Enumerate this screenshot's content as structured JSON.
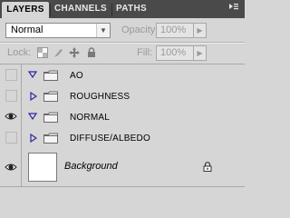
{
  "tabs": [
    {
      "label": "LAYERS",
      "active": true
    },
    {
      "label": "CHANNELS",
      "active": false
    },
    {
      "label": "PATHS",
      "active": false
    }
  ],
  "panel_menu_icon": "panel-menu-icon",
  "options": {
    "blend_mode": "Normal",
    "opacity_label": "Opacity:",
    "opacity_value": "100%",
    "lock_label": "Lock:",
    "fill_label": "Fill:",
    "fill_value": "100%"
  },
  "layers": [
    {
      "name": "AO",
      "type": "group",
      "expanded": true,
      "visible": false
    },
    {
      "name": "ROUGHNESS",
      "type": "group",
      "expanded": false,
      "visible": false
    },
    {
      "name": "NORMAL",
      "type": "group",
      "expanded": true,
      "visible": true
    },
    {
      "name": "DIFFUSE/ALBEDO",
      "type": "group",
      "expanded": false,
      "visible": false
    },
    {
      "name": "Background",
      "type": "background",
      "visible": true,
      "locked": true
    }
  ]
}
